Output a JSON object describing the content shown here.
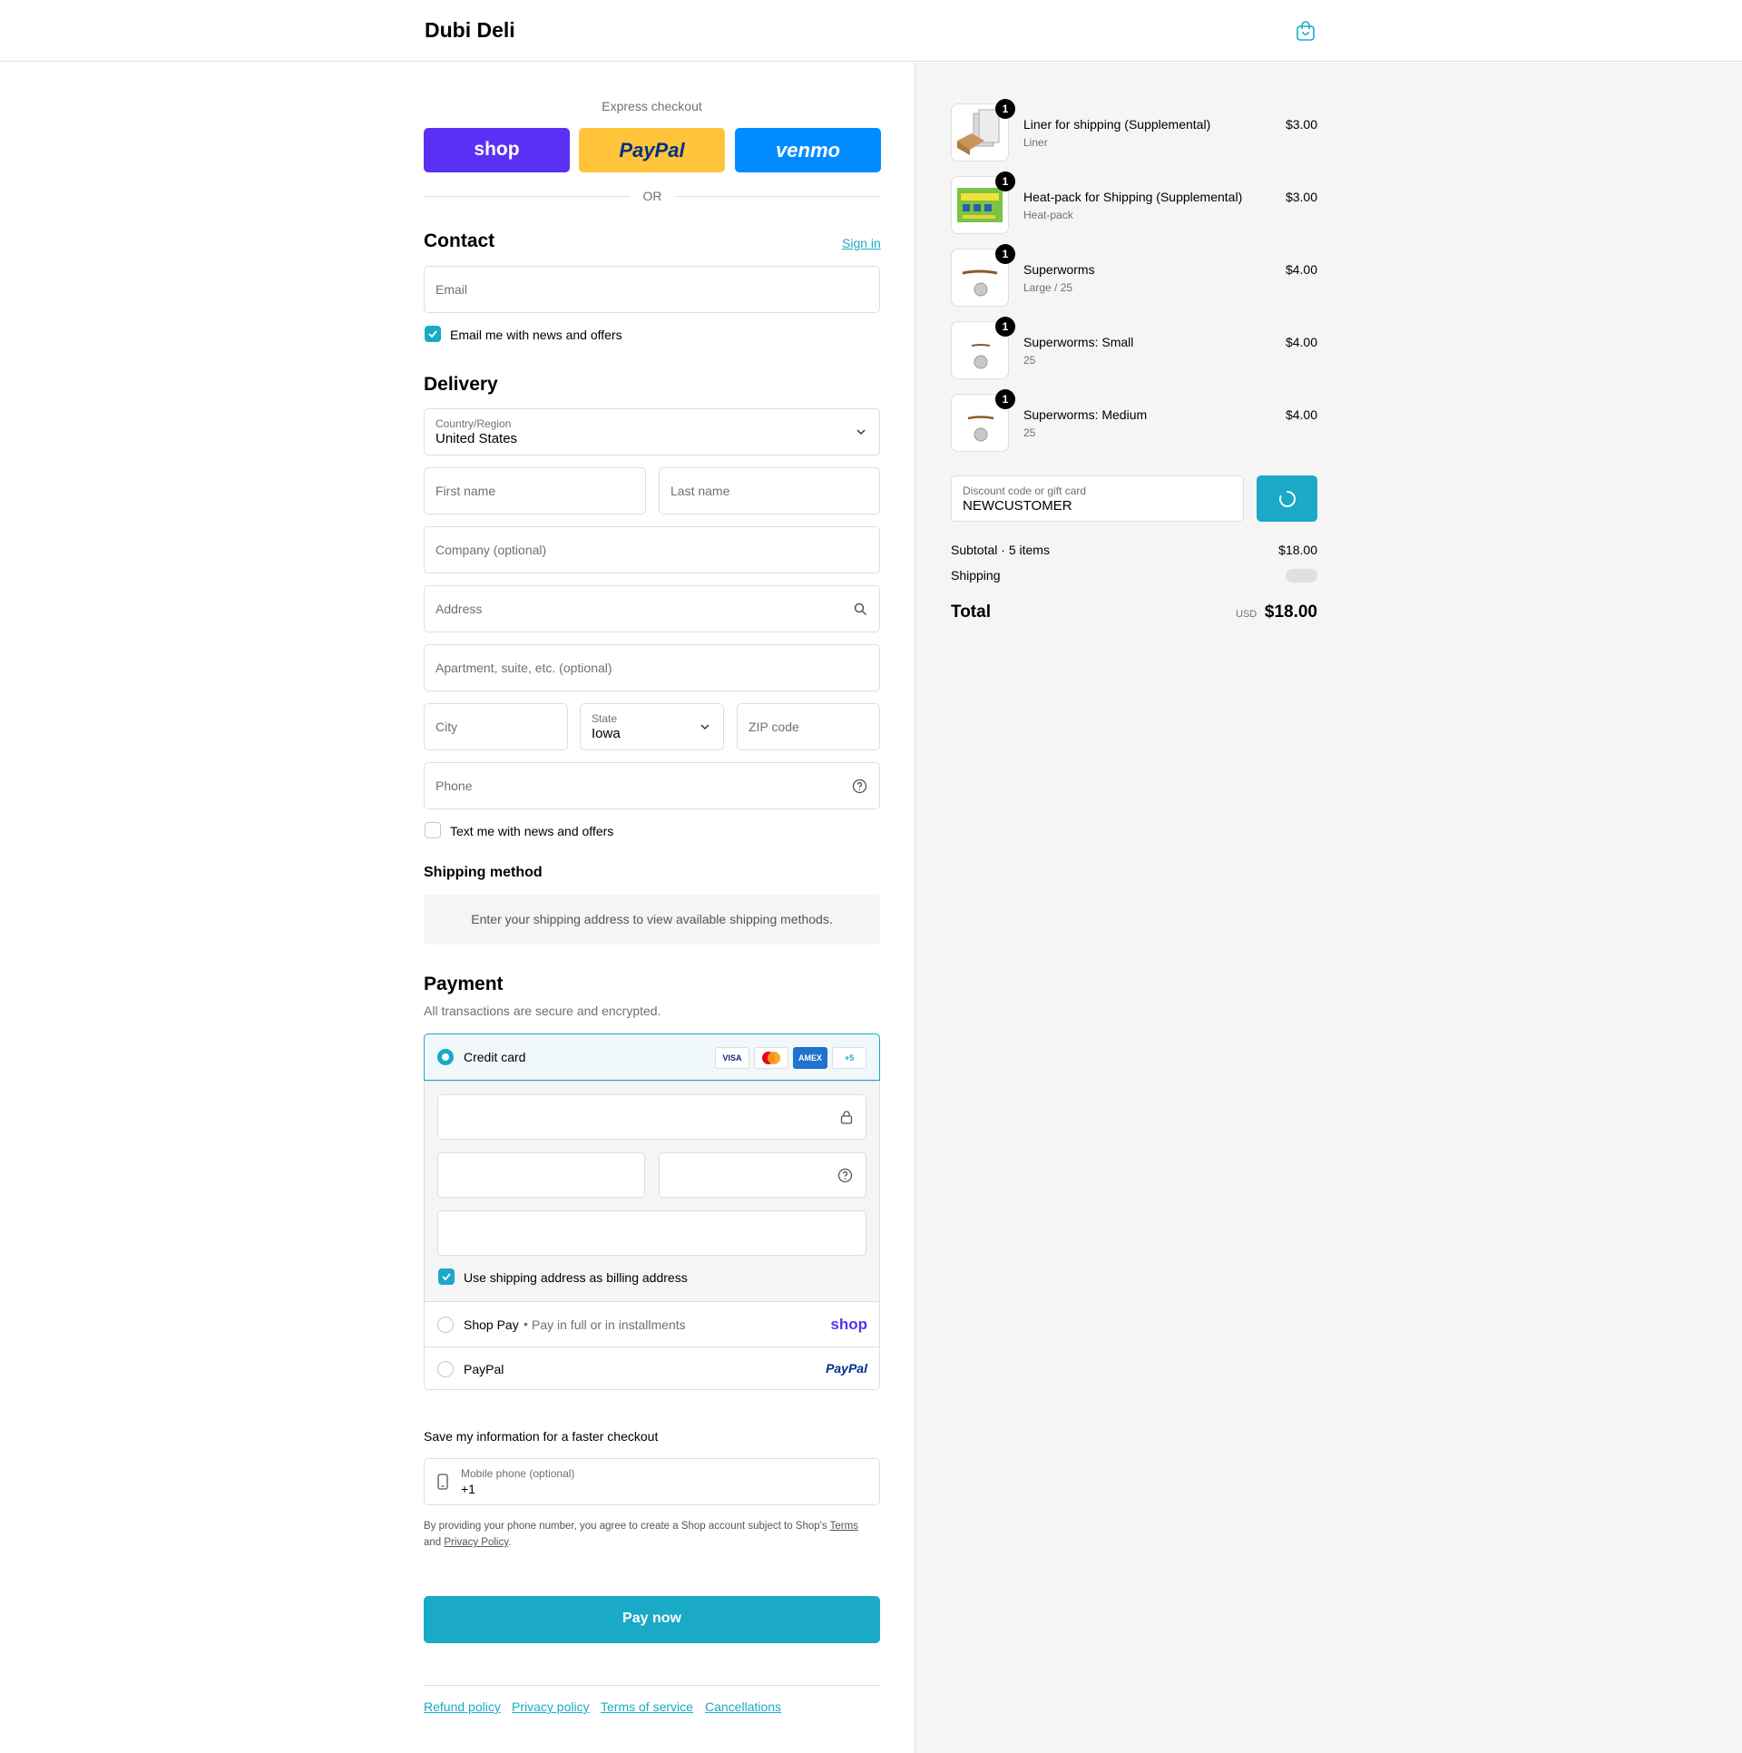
{
  "header": {
    "brand": "Dubi Deli"
  },
  "express": {
    "label": "Express checkout",
    "buttons": [
      {
        "label": "shop",
        "color": "#5a31f4"
      },
      {
        "label": "PayPal",
        "color": "#ffc439"
      },
      {
        "label": "venmo",
        "color": "#008cff"
      }
    ],
    "or": "OR"
  },
  "contact": {
    "title": "Contact",
    "sign_in": "Sign in",
    "email_placeholder": "Email",
    "news_label": "Email me with news and offers",
    "news_checked": true
  },
  "delivery": {
    "title": "Delivery",
    "country_label": "Country/Region",
    "country_value": "United States",
    "first_name": "First name",
    "last_name": "Last name",
    "company": "Company (optional)",
    "address": "Address",
    "apartment": "Apartment, suite, etc. (optional)",
    "city": "City",
    "state_label": "State",
    "state_value": "Iowa",
    "zip": "ZIP code",
    "phone": "Phone",
    "text_label": "Text me with news and offers",
    "text_checked": false
  },
  "shipping_method": {
    "title": "Shipping method",
    "notice": "Enter your shipping address to view available shipping methods."
  },
  "payment": {
    "title": "Payment",
    "subtitle": "All transactions are secure and encrypted.",
    "credit_card": "Credit card",
    "card_logos": [
      "VISA",
      "mastercard",
      "AMEX",
      "+5"
    ],
    "billing_label": "Use shipping address as billing address",
    "shop_pay": "Shop Pay",
    "shop_pay_note": "Pay in full or in installments",
    "shop_pay_logo": "shop",
    "paypal": "PayPal",
    "paypal_logo": "PayPal"
  },
  "save_info": {
    "title": "Save my information for a faster checkout",
    "mobile_label": "Mobile phone (optional)",
    "mobile_value": "+1",
    "disclaimer_1": "By providing your phone number, you agree to create a Shop account subject to Shop's",
    "terms": "Terms",
    "disclaimer_2": "and",
    "privacy": "Privacy Policy",
    "period": "."
  },
  "pay_now": "Pay now",
  "footer_links": [
    "Refund policy",
    "Privacy policy",
    "Terms of service",
    "Cancellations"
  ],
  "summary": {
    "items": [
      {
        "title": "Liner for shipping (Supplemental)",
        "variant": "Liner",
        "price": "$3.00",
        "qty": "1"
      },
      {
        "title": "Heat-pack for Shipping (Supplemental)",
        "variant": "Heat-pack",
        "price": "$3.00",
        "qty": "1"
      },
      {
        "title": "Superworms",
        "variant": "Large / 25",
        "price": "$4.00",
        "qty": "1"
      },
      {
        "title": "Superworms: Small",
        "variant": "25",
        "price": "$4.00",
        "qty": "1"
      },
      {
        "title": "Superworms: Medium",
        "variant": "25",
        "price": "$4.00",
        "qty": "1"
      }
    ],
    "discount_label": "Discount code or gift card",
    "discount_value": "NEWCUSTOMER",
    "subtotal_label": "Subtotal · 5 items",
    "subtotal_value": "$18.00",
    "shipping_label": "Shipping",
    "total_label": "Total",
    "currency": "USD",
    "total_value": "$18.00"
  },
  "colors": {
    "accent": "#1aa9c7",
    "border": "#dedede",
    "aside_bg": "#f5f5f5"
  }
}
